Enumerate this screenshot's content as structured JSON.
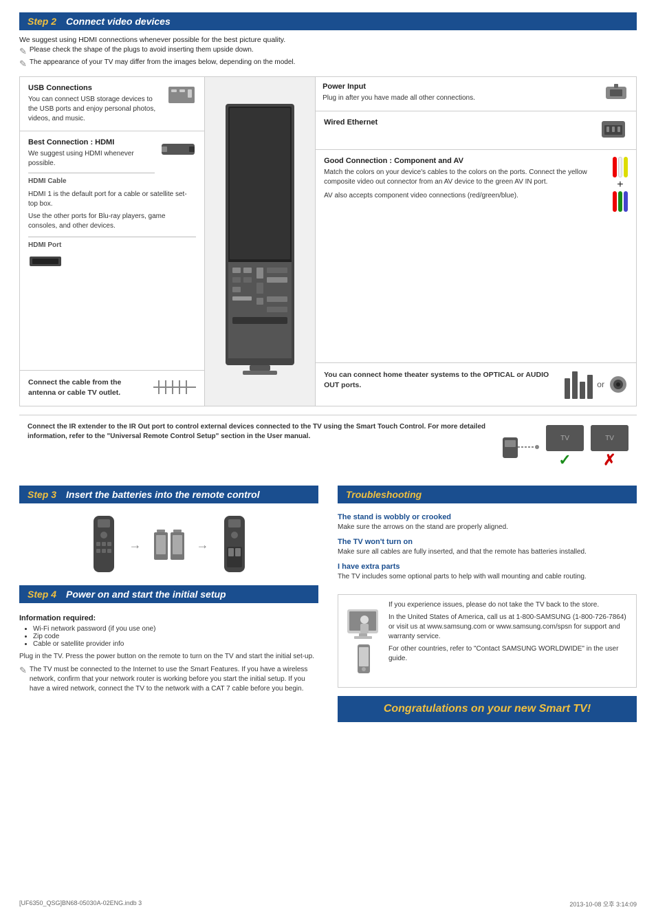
{
  "step2": {
    "num": "Step 2",
    "title": "Connect video devices",
    "intro": "We suggest using HDMI connections whenever possible for the best picture quality.",
    "note1": "Please check the shape of the plugs to avoid inserting them upside down.",
    "note2": "The appearance of your TV may differ from the images below, depending on the model.",
    "power": {
      "title": "Power Input",
      "desc": "Plug in after you have made all other connections."
    },
    "usb": {
      "title": "USB Connections",
      "desc": "You can connect USB storage devices to the USB ports and enjoy personal photos, videos, and music."
    },
    "ethernet": {
      "title": "Wired Ethernet"
    },
    "hdmi": {
      "title": "Best Connection : HDMI",
      "cable_label": "HDMI Cable",
      "port_label": "HDMI Port",
      "desc1": "We suggest using HDMI whenever possible.",
      "desc2": "HDMI 1 is the default port for a cable or satellite set-top box.",
      "desc3": "Use the other ports for Blu-ray players, game consoles, and other devices."
    },
    "antenna": {
      "desc": "Connect the cable from the antenna or cable TV outlet."
    },
    "component": {
      "title": "Good Connection : Component and AV",
      "desc": "Match the colors on your device's cables to the colors on the ports. Connect the yellow composite video out connector from an AV device to the green AV IN port.",
      "av_note": "AV also accepts component video connections (red/green/blue)."
    },
    "optical": {
      "desc": "You can connect home theater systems to the OPTICAL or AUDIO OUT ports."
    },
    "or_label": "or",
    "ir": {
      "desc": "Connect the IR extender to the IR Out port to control external devices connected to the TV using the Smart Touch Control. For more detailed information, refer to the \"Universal Remote Control Setup\" section in the User manual."
    }
  },
  "step3": {
    "num": "Step 3",
    "title": "Insert the batteries into the remote control"
  },
  "step4": {
    "num": "Step 4",
    "title": "Power on and start the initial setup",
    "info_title": "Information required:",
    "info_items": [
      "Wi-Fi network password (if you use one)",
      "Zip code",
      "Cable or satellite provider info"
    ],
    "desc": "Plug in the TV. Press the power button on the remote to turn on the TV and start the initial set-up.",
    "note": "The TV must be connected to the Internet to use the Smart Features. If you have a wireless network, confirm that your network router is working before you start the initial setup. If you have a wired network, connect the TV to the network with a CAT 7 cable before you begin."
  },
  "troubleshooting": {
    "title": "Troubleshooting",
    "items": [
      {
        "title": "The stand is wobbly or crooked",
        "desc": "Make sure the arrows on the stand are properly aligned."
      },
      {
        "title": "The TV won't turn on",
        "desc": "Make sure all cables are fully inserted, and that the remote has batteries installed."
      },
      {
        "title": "I have extra parts",
        "desc": "The TV includes some optional parts to help with wall mounting and cable routing."
      }
    ],
    "support": {
      "desc1": "If you experience issues, please do not take the TV back to the store.",
      "desc2": "In the United States of America, call us at 1-800-SAMSUNG (1-800-726-7864) or visit us at www.samsung.com or www.samsung.com/spsn for support and warranty service.",
      "desc3": "For other countries, refer to \"Contact SAMSUNG WORLDWIDE\" in the user guide."
    }
  },
  "congrats": {
    "text": "Congratulations on your new Smart TV!"
  },
  "footer": {
    "left": "[UF6350_QSG]BN68-05030A-02ENG.indb   3",
    "right": "2013-10-08   오후 3:14:09"
  }
}
